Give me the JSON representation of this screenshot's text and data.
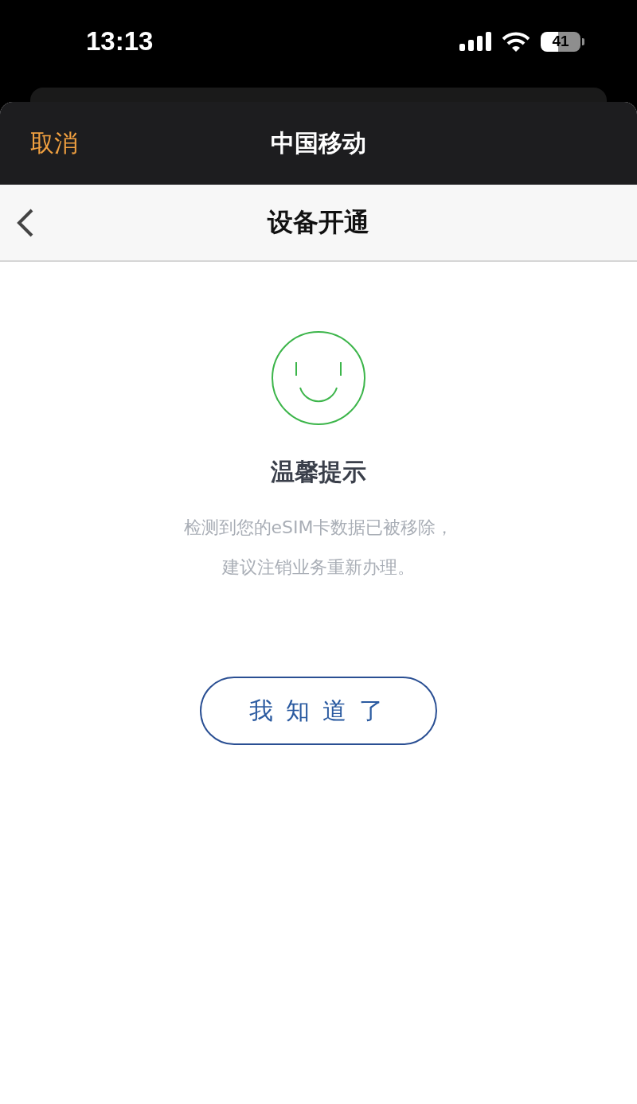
{
  "status_bar": {
    "time": "13:13",
    "battery": "41"
  },
  "sheet_header": {
    "cancel": "取消",
    "title": "中国移动"
  },
  "nav_bar": {
    "title": "设备开通"
  },
  "notice": {
    "title": "温馨提示",
    "message_lines": [
      "检测到您的eSIM卡数据已被移除，",
      "建议注销业务重新办理。"
    ],
    "button": "我知道了"
  }
}
